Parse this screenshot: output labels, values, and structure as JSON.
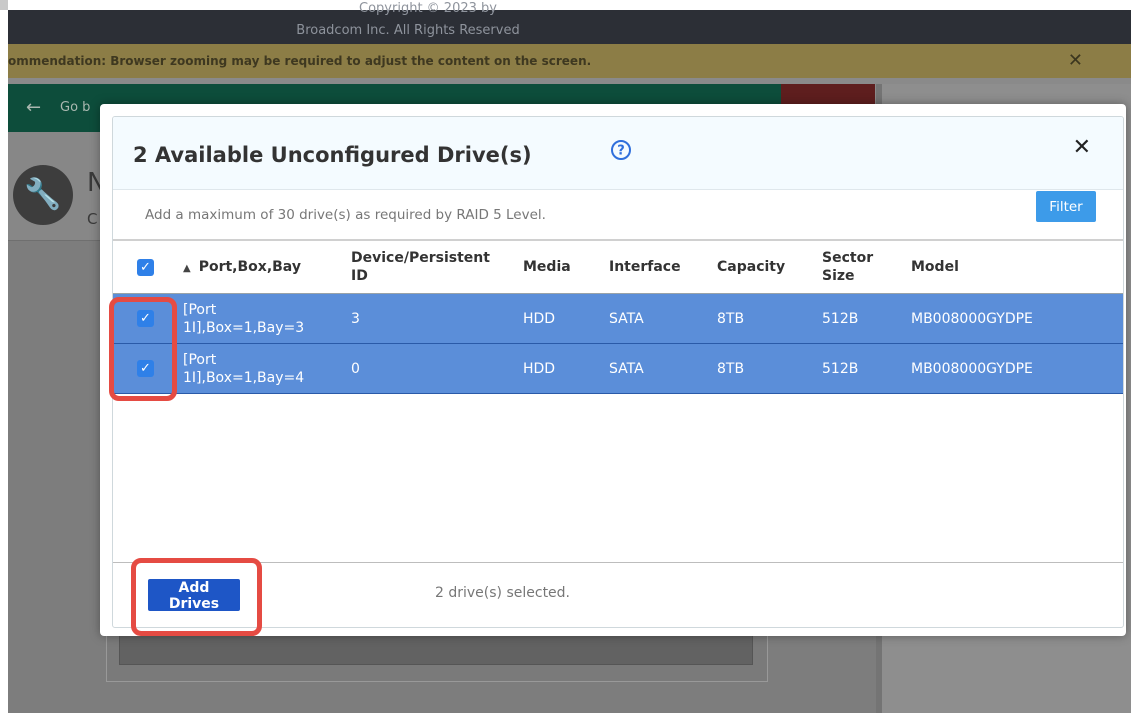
{
  "background": {
    "footer": {
      "line1": "Copyright © 2023 by",
      "line2": "Broadcom Inc. All Rights Reserved"
    },
    "banner": {
      "text": "ommendation: Browser zooming may be required to adjust the content on the screen.",
      "close": "✕"
    },
    "nav": {
      "back_label": "Go b"
    },
    "header_letter": "N",
    "header_sub": "C"
  },
  "modal": {
    "title": "2 Available Unconfigured Drive(s)",
    "help_icon": "question-circle-icon",
    "close": "✕",
    "subtitle": "Add a maximum of 30 drive(s) as required by RAID 5 Level.",
    "filter_label": "Filter",
    "columns": {
      "port": "Port,Box,Bay",
      "device_id_line1": "Device/Persistent",
      "device_id_line2": "ID",
      "media": "Media",
      "interface": "Interface",
      "capacity": "Capacity",
      "sector_line1": "Sector",
      "sector_line2": "Size",
      "model": "Model"
    },
    "rows": [
      {
        "port_line1": "[Port",
        "port_line2": "1I],Box=1,Bay=3",
        "device_id": "3",
        "media": "HDD",
        "interface": "SATA",
        "capacity": "8TB",
        "sector": "512B",
        "model": "MB008000GYDPE"
      },
      {
        "port_line1": "[Port",
        "port_line2": "1I],Box=1,Bay=4",
        "device_id": "0",
        "media": "HDD",
        "interface": "SATA",
        "capacity": "8TB",
        "sector": "512B",
        "model": "MB008000GYDPE"
      }
    ],
    "add_button": "Add Drives",
    "selected_text": "2 drive(s) selected."
  },
  "colors": {
    "highlight": "#e54b43",
    "row_selected": "#5b8ed9",
    "primary": "#1e56c6",
    "filter": "#3d9be9"
  }
}
